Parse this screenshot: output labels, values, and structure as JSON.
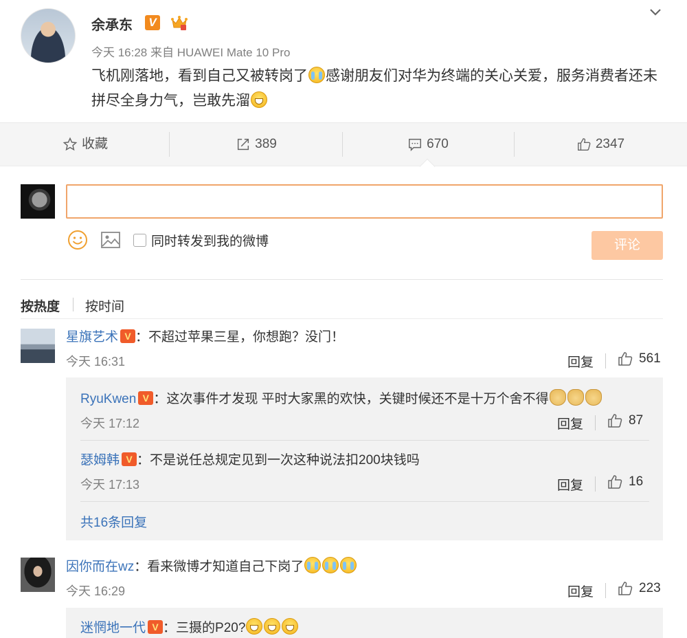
{
  "post": {
    "author": "余承东",
    "v_badge": "V",
    "time": "今天 16:28",
    "source_prefix": "来自",
    "source": "HUAWEI Mate 10 Pro",
    "text_part1": "飞机刚落地，看到自己又被转岗了",
    "text_part2": "感谢朋友们对华为终端的关心关爱，服务消费者还未拼尽全身力气，岂敢先溜",
    "emoji_1": "cry-laugh-emoji",
    "emoji_2": "grin-emoji"
  },
  "actions": {
    "favorite_label": "收藏",
    "repost_count": "389",
    "comment_count": "670",
    "like_count": "2347"
  },
  "compose": {
    "input_value": "",
    "also_repost_label": "同时转发到我的微博",
    "submit_label": "评论",
    "accent_color": "#f0a56a"
  },
  "sort": {
    "hot_label": "按热度",
    "time_label": "按时间"
  },
  "comments": [
    {
      "name": "星旗艺术",
      "text": "：不超过苹果三星，你想跑？没门！",
      "time": "今天 16:31",
      "reply_label": "回复",
      "likes": "561",
      "replies": [
        {
          "name": "RyuKwen",
          "text": "：这次事件才发现  平时大家黑的欢快，关键时候还不是十万个舍不得",
          "time": "今天 17:12",
          "reply_label": "回复",
          "likes": "87"
        },
        {
          "name": "瑟姆韩",
          "text": "：不是说任总规定见到一次这种说法扣200块钱吗",
          "time": "今天 17:13",
          "reply_label": "回复",
          "likes": "16"
        }
      ],
      "more_replies": "共16条回复"
    },
    {
      "name": "因你而在wz",
      "text": "：看来微博才知道自己下岗了",
      "time": "今天 16:29",
      "reply_label": "回复",
      "likes": "223",
      "replies": [
        {
          "name": "迷惘地一代",
          "text": "：三摄的P20?"
        }
      ]
    }
  ]
}
